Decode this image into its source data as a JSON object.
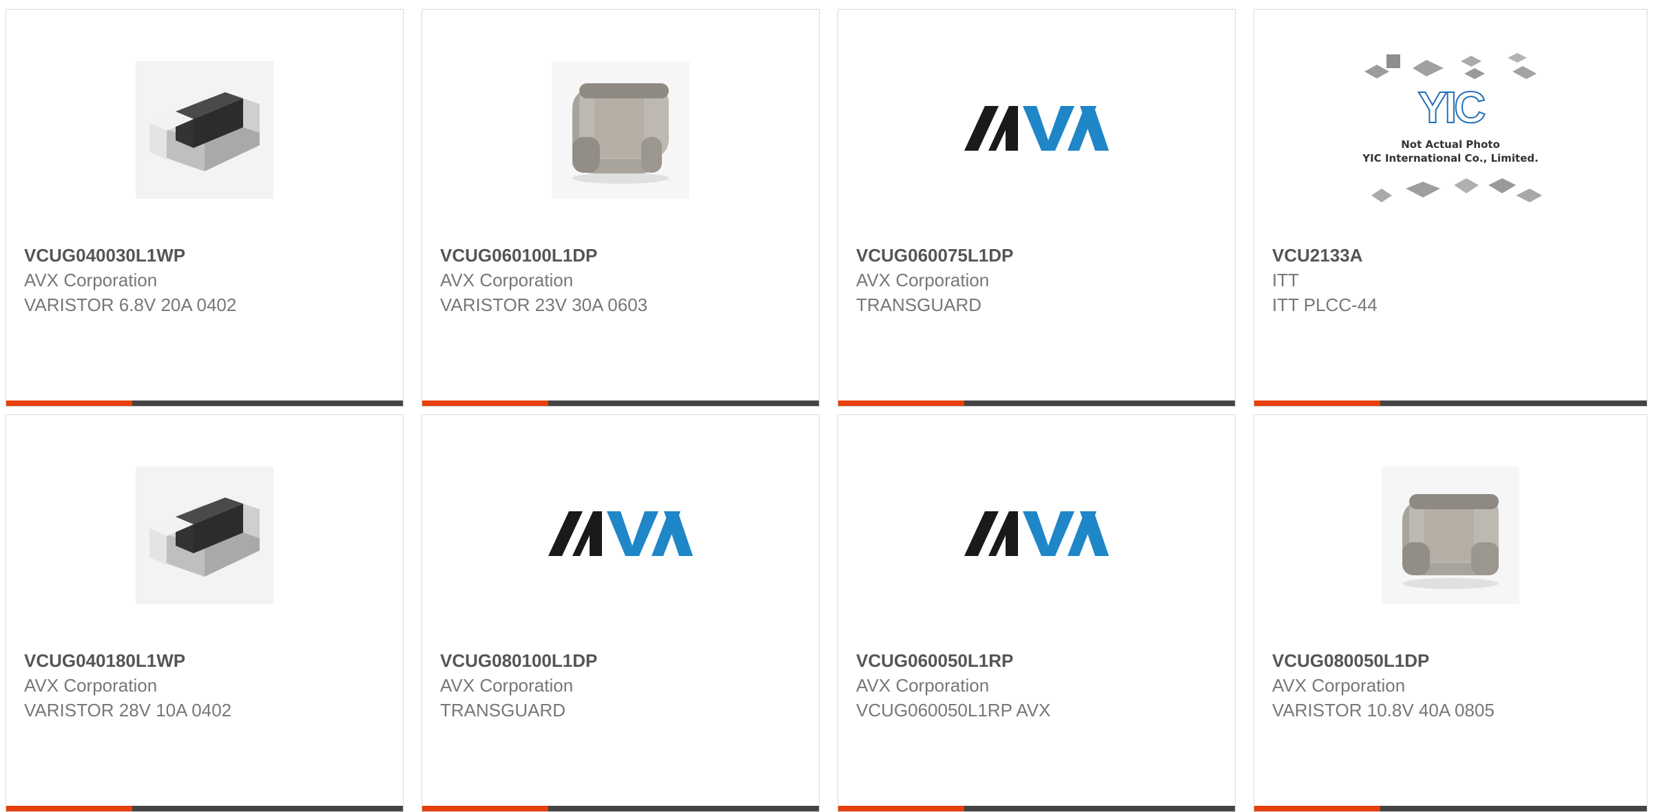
{
  "colors": {
    "accent": "#e8400c",
    "bar": "#444444",
    "avx_black": "#1a1a1a",
    "avx_blue": "#1f86c8"
  },
  "products": [
    {
      "part": "VCUG040030L1WP",
      "manufacturer": "AVX Corporation",
      "description": "VARISTOR 6.8V 20A 0402",
      "image": "chip-varistor-icon"
    },
    {
      "part": "VCUG060100L1DP",
      "manufacturer": "AVX Corporation",
      "description": "VARISTOR 23V 30A 0603",
      "image": "ceramic-chip-icon"
    },
    {
      "part": "VCUG060075L1DP",
      "manufacturer": "AVX Corporation",
      "description": "TRANSGUARD",
      "image": "avx-logo"
    },
    {
      "part": "VCU2133A",
      "manufacturer": "ITT",
      "description": "ITT PLCC-44",
      "image": "yic-placeholder",
      "placeholder_lines": [
        "Not Actual Photo",
        "YIC International Co., Limited."
      ],
      "placeholder_logo": "YIC"
    },
    {
      "part": "VCUG040180L1WP",
      "manufacturer": "AVX Corporation",
      "description": "VARISTOR 28V 10A 0402",
      "image": "chip-varistor-icon"
    },
    {
      "part": "VCUG080100L1DP",
      "manufacturer": "AVX Corporation",
      "description": "TRANSGUARD",
      "image": "avx-logo"
    },
    {
      "part": "VCUG060050L1RP",
      "manufacturer": "AVX Corporation",
      "description": "VCUG060050L1RP AVX",
      "image": "avx-logo"
    },
    {
      "part": "VCUG080050L1DP",
      "manufacturer": "AVX Corporation",
      "description": "VARISTOR 10.8V 40A 0805",
      "image": "ceramic-chip-icon"
    }
  ],
  "avx_logo_text": "AVX"
}
